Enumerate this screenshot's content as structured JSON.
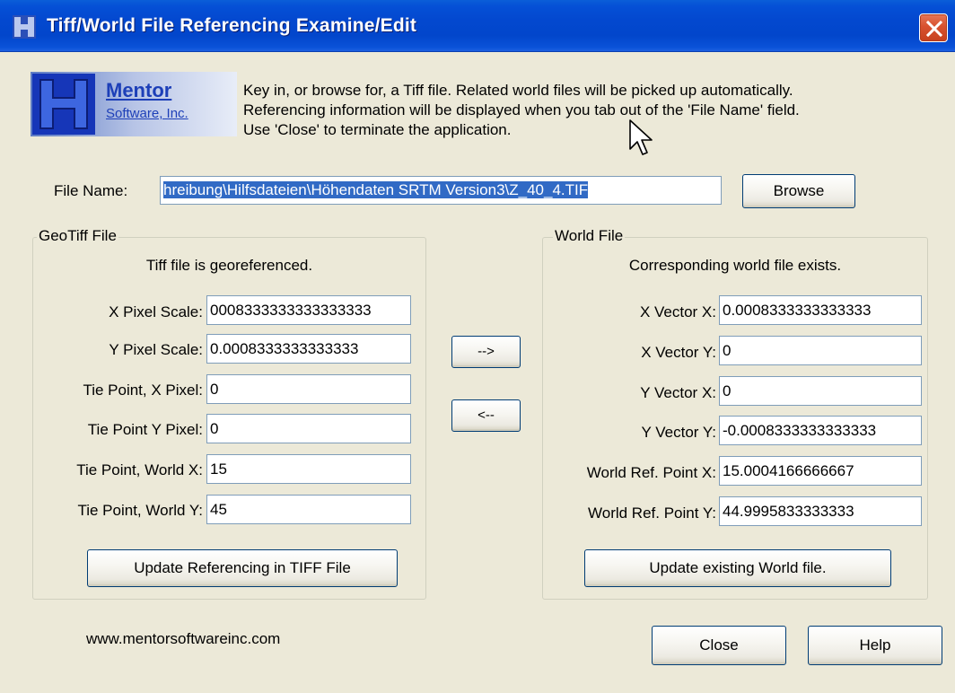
{
  "window": {
    "title": "Tiff/World File Referencing Examine/Edit"
  },
  "logo": {
    "name": "Mentor",
    "subtitle": "Software, Inc."
  },
  "instructions": {
    "line1": "Key in, or browse for, a Tiff file.  Related world files will be picked up automatically.",
    "line2": "Referencing information will be displayed when you tab out of the 'File Name' field.",
    "line3": "Use 'Close' to terminate the application."
  },
  "file": {
    "label": "File Name:",
    "value": "hreibung\\Hilfsdateien\\Höhendaten SRTM Version3\\Z_40_4.TIF",
    "browse_label": "Browse"
  },
  "geotiff": {
    "title": "GeoTiff File",
    "status": "Tiff file is georeferenced.",
    "fields": [
      {
        "label": "X Pixel Scale:",
        "value": "0008333333333333333"
      },
      {
        "label": "Y Pixel Scale:",
        "value": "0.0008333333333333"
      },
      {
        "label": "Tie Point, X Pixel:",
        "value": "0"
      },
      {
        "label": "Tie Point Y Pixel:",
        "value": "0"
      },
      {
        "label": "Tie Point, World X:",
        "value": "15"
      },
      {
        "label": "Tie Point, World Y:",
        "value": "45"
      }
    ],
    "update_label": "Update Referencing in TIFF File"
  },
  "transfer": {
    "to_world_label": "-->",
    "to_tiff_label": "<--"
  },
  "world": {
    "title": "World File",
    "status": "Corresponding world file exists.",
    "fields": [
      {
        "label": "X Vector X:",
        "value": "0.0008333333333333"
      },
      {
        "label": "X Vector Y:",
        "value": "0"
      },
      {
        "label": "Y Vector X:",
        "value": "0"
      },
      {
        "label": "Y Vector Y:",
        "value": "-0.0008333333333333"
      },
      {
        "label": "World Ref. Point X:",
        "value": "15.0004166666667"
      },
      {
        "label": "World Ref. Point Y:",
        "value": "44.9995833333333"
      }
    ],
    "update_label": "Update existing World file."
  },
  "footer": {
    "url": "www.mentorsoftwareinc.com",
    "close_label": "Close",
    "help_label": "Help"
  },
  "colors": {
    "titlebar": "#0348cf",
    "dialog_bg": "#ece9d8",
    "selection": "#316ac5",
    "logo_blue": "#1d3fb8"
  }
}
